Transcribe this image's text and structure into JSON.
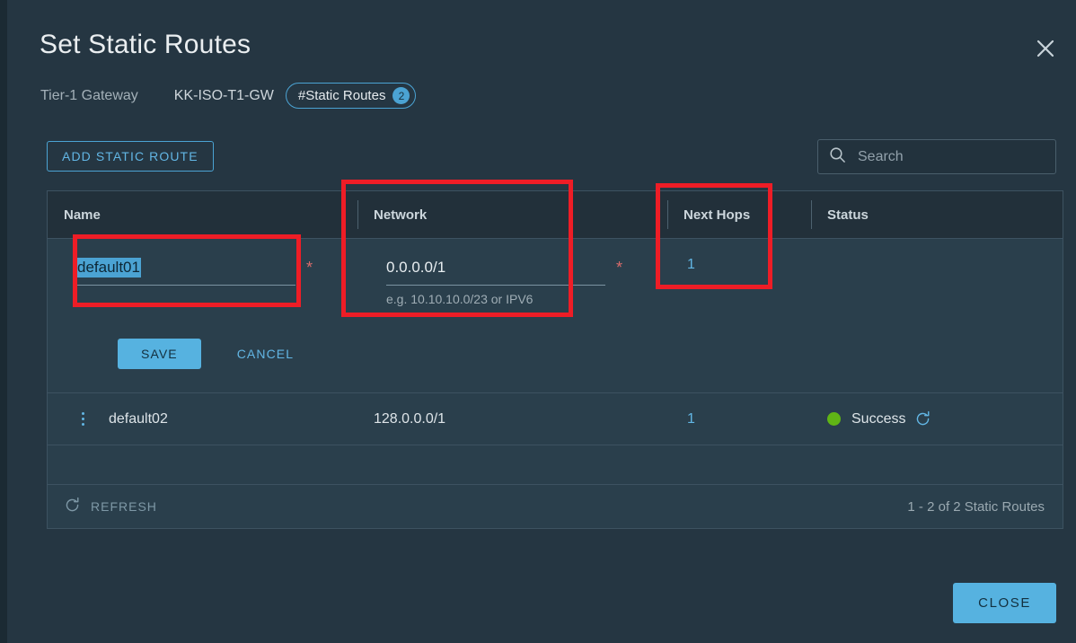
{
  "dialog": {
    "title": "Set Static Routes",
    "close_icon": "close-icon"
  },
  "breadcrumb": {
    "level_label": "Tier-1 Gateway",
    "gateway_name": "KK-ISO-T1-GW",
    "chip_label": "#Static Routes",
    "chip_count": "2"
  },
  "toolbar": {
    "add_label": "ADD STATIC ROUTE",
    "search_placeholder": "Search",
    "search_value": ""
  },
  "table": {
    "columns": [
      "Name",
      "Network",
      "Next Hops",
      "Status"
    ],
    "edit_row": {
      "name_value": "default01",
      "name_required": "*",
      "network_value": "0.0.0.0/1",
      "network_helper": "e.g. 10.10.10.0/23 or IPV6",
      "network_required": "*",
      "next_hops": "1",
      "save_label": "SAVE",
      "cancel_label": "CANCEL"
    },
    "rows": [
      {
        "name": "default02",
        "network": "128.0.0.0/1",
        "next_hops": "1",
        "status": "Success",
        "status_color": "#60b515"
      }
    ],
    "footer": {
      "refresh_label": "REFRESH",
      "count_label": "1 - 2 of 2 Static Routes"
    }
  },
  "footer": {
    "close_label": "CLOSE"
  },
  "annotations": {
    "accent": "#ee1d26"
  }
}
